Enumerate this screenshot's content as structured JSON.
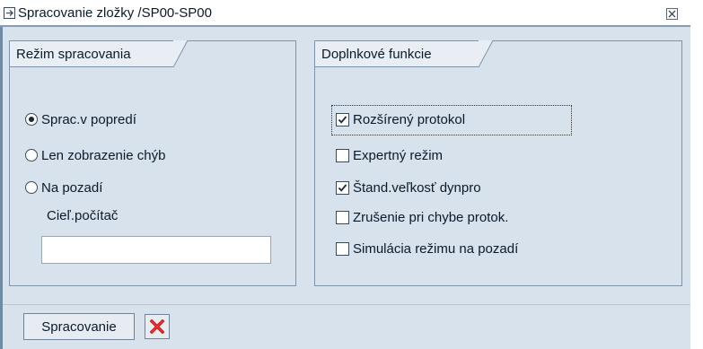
{
  "window": {
    "title": "Spracovanie zložky /SP00-SP00",
    "close_icon": "close-icon"
  },
  "processing_mode": {
    "heading": "Režim spracovania",
    "options": [
      {
        "label": "Sprac.v popredí",
        "selected": true
      },
      {
        "label": "Len zobrazenie chýb",
        "selected": false
      },
      {
        "label": "Na pozadí",
        "selected": false
      }
    ],
    "target_computer": {
      "label": "Cieľ.počítač",
      "value": ""
    }
  },
  "additional_functions": {
    "heading": "Doplnkové funkcie",
    "options": [
      {
        "label": "Rozšírený protokol",
        "checked": true
      },
      {
        "label": "Expertný režim",
        "checked": false
      },
      {
        "label": "Štand.veľkosť dynpro",
        "checked": true
      },
      {
        "label": "Zrušenie pri chybe protok.",
        "checked": false
      },
      {
        "label": "Simulácia režimu na pozadí",
        "checked": false
      }
    ]
  },
  "footer": {
    "process_button": "Spracovanie",
    "cancel_icon": "cancel-icon",
    "cancel_color": "#cc1111"
  }
}
